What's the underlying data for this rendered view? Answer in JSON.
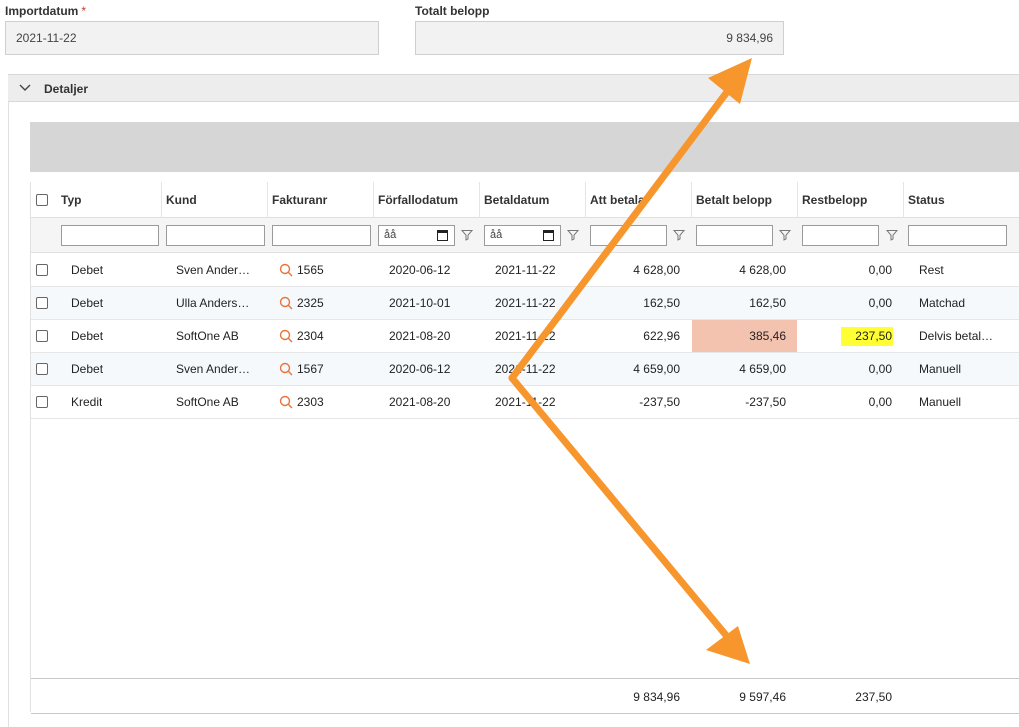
{
  "form": {
    "import_date_label": "Importdatum",
    "required_mark": "*",
    "import_date_value": "2021-11-22",
    "total_label": "Totalt belopp",
    "total_value": "9 834,96"
  },
  "section": {
    "title": "Detaljer"
  },
  "grid": {
    "columns": [
      "Typ",
      "Kund",
      "Fakturanr",
      "Förfallodatum",
      "Betaldatum",
      "Att betala",
      "Betalt belopp",
      "Restbelopp",
      "Status"
    ],
    "date_placeholder": "åå",
    "rows": [
      {
        "typ": "Debet",
        "kund": "Sven Ander…",
        "faktura": "1565",
        "forfall": "2020-06-12",
        "betal": "2021-11-22",
        "att": "4 628,00",
        "betalt": "4 628,00",
        "rest": "0,00",
        "status": "Rest"
      },
      {
        "typ": "Debet",
        "kund": "Ulla Anders…",
        "faktura": "2325",
        "forfall": "2021-10-01",
        "betal": "2021-11-22",
        "att": "162,50",
        "betalt": "162,50",
        "rest": "0,00",
        "status": "Matchad"
      },
      {
        "typ": "Debet",
        "kund": "SoftOne AB",
        "faktura": "2304",
        "forfall": "2021-08-20",
        "betal": "2021-11-22",
        "att": "622,96",
        "betalt": "385,46",
        "rest": "237,50",
        "status": "Delvis betal…"
      },
      {
        "typ": "Debet",
        "kund": "Sven Ander…",
        "faktura": "1567",
        "forfall": "2020-06-12",
        "betal": "2021-11-22",
        "att": "4 659,00",
        "betalt": "4 659,00",
        "rest": "0,00",
        "status": "Manuell"
      },
      {
        "typ": "Kredit",
        "kund": "SoftOne AB",
        "faktura": "2303",
        "forfall": "2021-08-20",
        "betal": "2021-11-22",
        "att": "-237,50",
        "betalt": "-237,50",
        "rest": "0,00",
        "status": "Manuell"
      }
    ],
    "totals": {
      "att": "9 834,96",
      "betalt": "9 597,46",
      "rest": "237,50"
    }
  },
  "colors": {
    "accent_arrow": "#f7962d",
    "highlight_partial": "#f4c3b0",
    "highlight_rest": "#ffff33",
    "search_icon": "#e8743b"
  }
}
